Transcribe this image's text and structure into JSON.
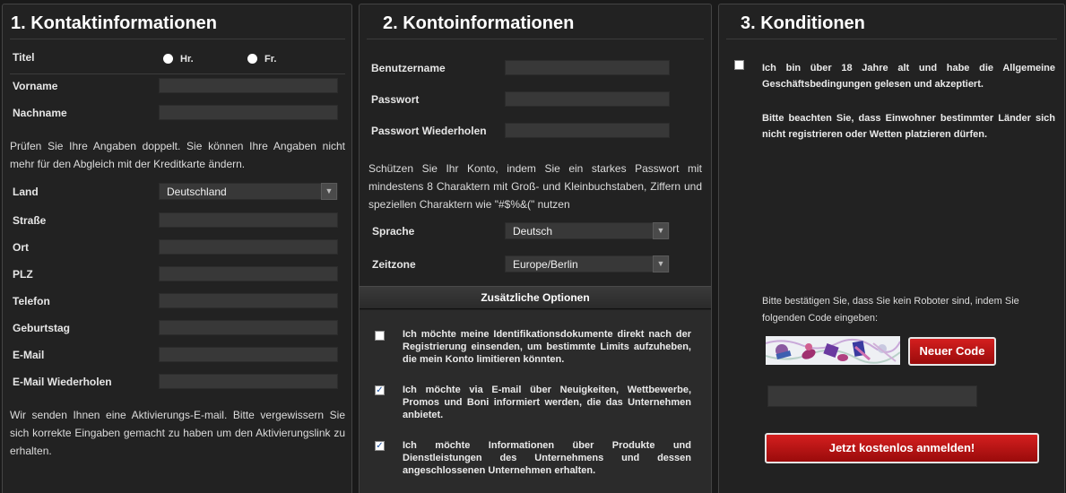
{
  "contact": {
    "title": "1. Kontaktinformationen",
    "salutation_label": "Titel",
    "salutation_options": [
      "Hr.",
      "Fr."
    ],
    "firstname_label": "Vorname",
    "lastname_label": "Nachname",
    "verify_note": "Prüfen Sie Ihre Angaben doppelt. Sie können Ihre Angaben nicht mehr für den Abgleich mit der Kreditkarte ändern.",
    "country_label": "Land",
    "country_value": "Deutschland",
    "street_label": "Straße",
    "city_label": "Ort",
    "zip_label": "PLZ",
    "phone_label": "Telefon",
    "birthday_label": "Geburtstag",
    "email_label": "E-Mail",
    "email_repeat_label": "E-Mail Wiederholen",
    "activation_note": "Wir senden Ihnen eine Aktivierungs-E-mail. Bitte vergewissern Sie sich korrekte Eingaben gemacht zu haben um den Aktivierungslink zu erhalten."
  },
  "account": {
    "title": "2. Kontoinformationen",
    "username_label": "Benutzername",
    "password_label": "Passwort",
    "password_repeat_label": "Passwort Wiederholen",
    "password_note": "Schützen Sie Ihr Konto, indem Sie ein starkes Passwort mit mindestens 8 Charaktern mit Groß- und Kleinbuchstaben, Ziffern und speziellen Charaktern wie \"#$%&(\" nutzen",
    "language_label": "Sprache",
    "language_value": "Deutsch",
    "timezone_label": "Zeitzone",
    "timezone_value": "Europe/Berlin",
    "options_title": "Zusätzliche Optionen",
    "options": [
      {
        "text": "Ich möchte meine Identifikationsdokumente direkt nach der Registrierung einsenden, um bestimmte Limits aufzuheben, die mein Konto limitieren könnten.",
        "checked": false
      },
      {
        "text": "Ich möchte via E-mail über Neuigkeiten, Wettbewerbe, Promos und Boni informiert werden, die das Unternehmen anbietet.",
        "checked": true
      },
      {
        "text": "Ich möchte Informationen über Produkte und Dienstleistungen des Unternehmens und dessen angeschlossenen Unternehmen erhalten.",
        "checked": true
      }
    ]
  },
  "conditions": {
    "title": "3. Konditionen",
    "terms_text": "Ich bin über 18 Jahre alt und habe die Allgemeine Geschäftsbedingungen gelesen und akzeptiert.",
    "residents_note": "Bitte beachten Sie, dass Einwohner bestimmter Länder sich nicht registrieren oder Wetten platzieren dürfen.",
    "captcha_prompt": "Bitte bestätigen Sie, dass Sie kein Roboter sind, indem Sie folgenden Code eingeben:",
    "new_code_label": "Neuer Code",
    "submit_label": "Jetzt kostenlos anmelden!"
  },
  "colors": {
    "accent_red": "#c01414",
    "panel_bg": "#222222",
    "field_bg": "#383838"
  }
}
